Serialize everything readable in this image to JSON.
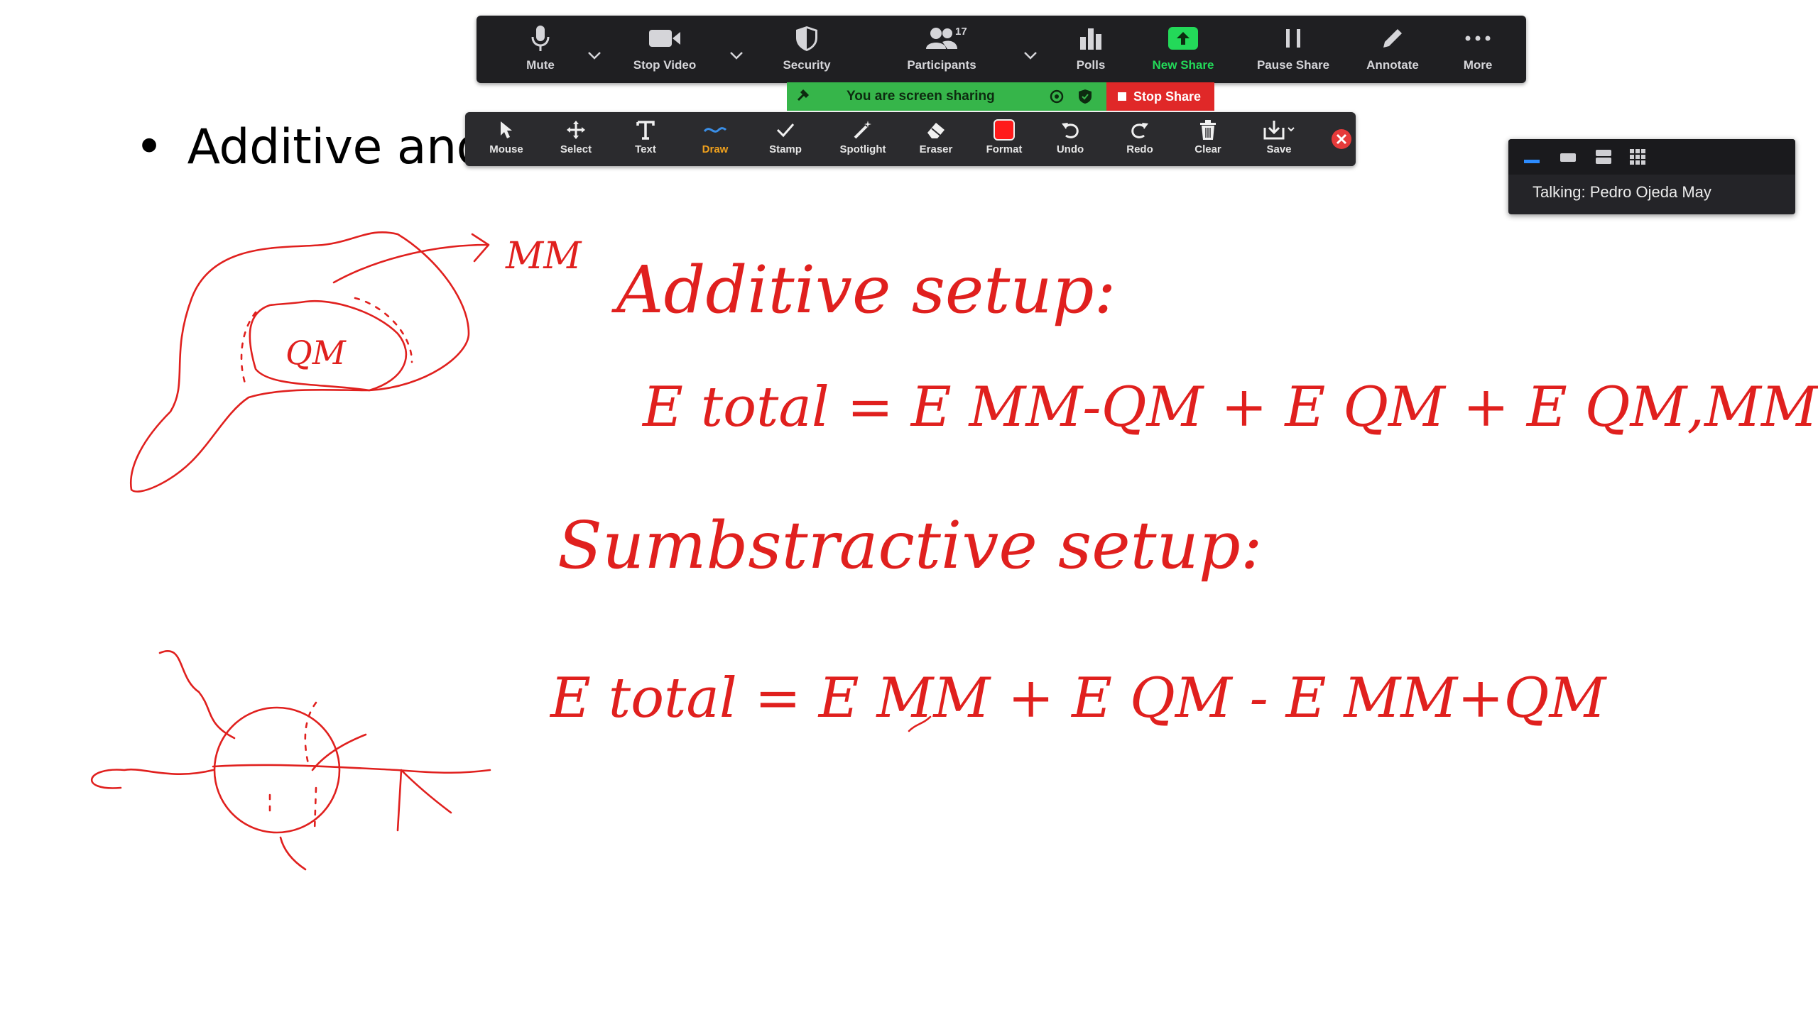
{
  "slide": {
    "bullet_text": "Additive and subtractive schemes"
  },
  "meeting_toolbar": {
    "mute": "Mute",
    "stop_video": "Stop Video",
    "security": "Security",
    "participants": "Participants",
    "participants_count": "17",
    "polls": "Polls",
    "new_share": "New Share",
    "pause_share": "Pause Share",
    "annotate": "Annotate",
    "more": "More"
  },
  "share_banner": {
    "text": "You are screen sharing",
    "stop_label": "Stop Share"
  },
  "annotate_toolbar": {
    "mouse": "Mouse",
    "select": "Select",
    "text": "Text",
    "draw": "Draw",
    "stamp": "Stamp",
    "spotlight": "Spotlight",
    "eraser": "Eraser",
    "format": "Format",
    "undo": "Undo",
    "redo": "Redo",
    "clear": "Clear",
    "save": "Save",
    "active_tool": "Draw",
    "format_color": "#ff1b1b"
  },
  "speaker_panel": {
    "talking_text": "Talking: Pedro Ojeda May"
  },
  "handwriting": {
    "ink_color": "#e0201e",
    "lines": [
      "MM",
      "QM",
      "Additive setup:",
      "E total = E MM-QM + E QM + E QM,MM",
      "Sumbstractive setup:",
      "E total = E MM + E QM - E MM+QM"
    ]
  },
  "colors": {
    "toolbar_bg": "#1f1f22",
    "banner_green": "#36b54a",
    "stop_red": "#e02828",
    "new_share_green": "#23d959",
    "draw_active_orange": "#f0a11d"
  }
}
